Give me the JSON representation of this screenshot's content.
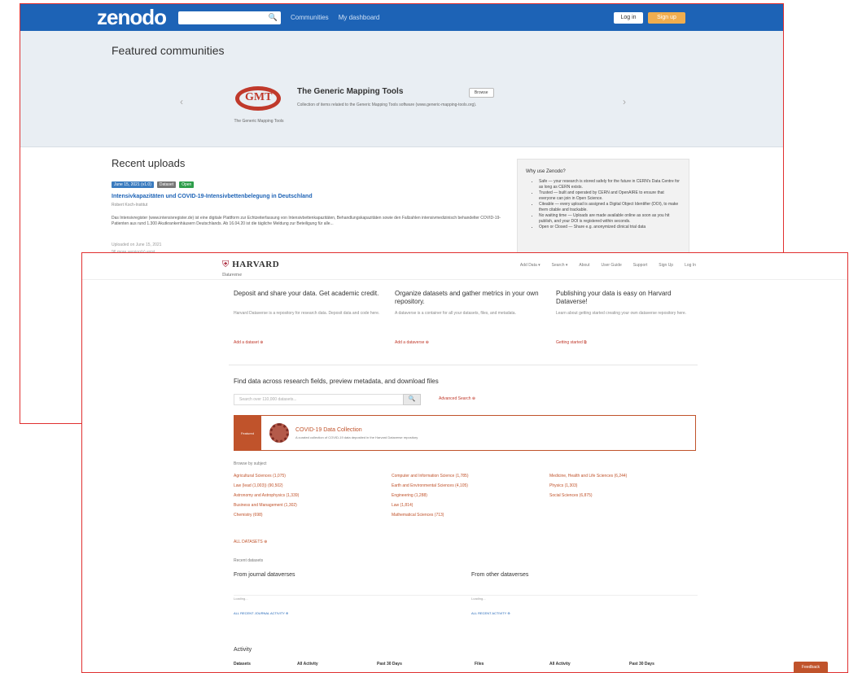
{
  "zenodo": {
    "logo": "zenodo",
    "search_icon": "🔍",
    "nav_links": [
      "Communities",
      "My dashboard"
    ],
    "login": "Log in",
    "signup": "Sign up",
    "featured_title": "Featured communities",
    "prev_arrow": "‹",
    "next_arrow": "›",
    "community": {
      "logo_text": "GMT",
      "logo_caption": "The Generic Mapping Tools",
      "name": "The Generic Mapping Tools",
      "button": "Browse",
      "description": "Collection of items related to the Generic Mapping Tools software (www.generic-mapping-tools.org)."
    },
    "recent_title": "Recent uploads",
    "badges": [
      {
        "label": "June 15, 2021 (v1.0)",
        "color": "#3a7bbf"
      },
      {
        "label": "Dataset",
        "color": "#777777"
      },
      {
        "label": "Open",
        "color": "#2e9e4b"
      }
    ],
    "record": {
      "title": "Intensivkapazitäten und COVID-19-Intensivbettenbelegung in Deutschland",
      "authors": "Robert Koch-Institut",
      "description": "Das Intensivregister (www.intensivregister.de) ist eine digitale Plattform zur Echtzeiterfassung von Intensivbettenkapazitäten, Behandlungskapazitäten sowie den Fallzahlen intensivmedizinisch behandelter COVID-19-Patienten aus rund 1.300 Akutkrankenhäusern Deutschlands. Ab 16.04.20 ist die tägliche Meldung zur Beteiligung für alle...",
      "uploaded": "Uploaded on June 15, 2021",
      "versions": "96 more version(s) exist"
    },
    "side": {
      "title": "Why use Zenodo?",
      "items": [
        "Safe — your research is stored safely for the future in CERN's Data Centre for as long as CERN exists.",
        "Trusted — built and operated by CERN and OpenAIRE to ensure that everyone can join in Open Science.",
        "Citeable — every upload is assigned a Digital Object Identifier (DOI), to make them citable and trackable.",
        "No waiting time — Uploads are made available online as soon as you hit publish, and your DOI is registered within seconds.",
        "Open or Closed — Share e.g. anonymized clinical trial data"
      ]
    }
  },
  "harvard": {
    "logo": {
      "shield": "⛨",
      "name": "HARVARD",
      "sub": "Dataverse"
    },
    "menu": [
      "Add Data ▾",
      "Search ▾",
      "About",
      "User Guide",
      "Support",
      "Sign Up",
      "Log In"
    ],
    "columns": [
      {
        "title": "Deposit and share your data. Get academic credit.",
        "text": "Harvard Dataverse is a repository for research data. Deposit data and code here.",
        "action": "Add a dataset ⊕"
      },
      {
        "title": "Organize datasets and gather metrics in your own repository.",
        "text": "A dataverse is a container for all your datasets, files, and metadata.",
        "action": "Add a dataverse ⊕"
      },
      {
        "title": "Publishing your data is easy on Harvard Dataverse!",
        "text": "Learn about getting started creating your own dataverse repository here.",
        "action": "Getting started ⧉"
      }
    ],
    "find_title": "Find data across research fields, preview metadata, and download files",
    "search_placeholder": "Search over 110,000 datasets...",
    "search_icon": "🔍",
    "advanced": "Advanced Search ⊕",
    "covid": {
      "tag": "Featured",
      "title": "COVID-19 Data Collection",
      "text": "A curated collection of COVID-19 data deposited in the Harvard Dataverse repository"
    },
    "browse_label": "Browse by subject",
    "subjects": [
      "Agricultural Sciences (1,075)",
      "Computer and Information Science (1,785)",
      "Medicine, Health and Life Sciences (6,244)",
      "Law (lead (1,003)) (90,502)",
      "Earth and Environmental Sciences (4,105)",
      "Physics (1,303)",
      "Astronomy and Astrophysics (1,339)",
      "Engineering (1,288)",
      "Social Sciences (6,875)",
      "Business and Management (1,302)",
      "Law (1,814)",
      "",
      "Chemistry (698)",
      "Mathematical Sciences (713)",
      ""
    ],
    "all_link": "ALL DATASETS ⊕",
    "recent_label": "Recent datasets",
    "dv_cols": [
      {
        "title": "From journal dataverses",
        "loading": "Loading...",
        "more": "ALL RECENT JOURNAL ACTIVITY ⊕"
      },
      {
        "title": "From other dataverses",
        "loading": "Loading...",
        "more": "ALL RECENT ACTIVITY ⊕"
      }
    ],
    "activity_title": "Activity",
    "activity_headers": [
      "Datasets",
      "All Activity",
      "Past 30 Days",
      "Files",
      "All Activity",
      "Past 30 Days"
    ],
    "feedback": "Feedback"
  }
}
